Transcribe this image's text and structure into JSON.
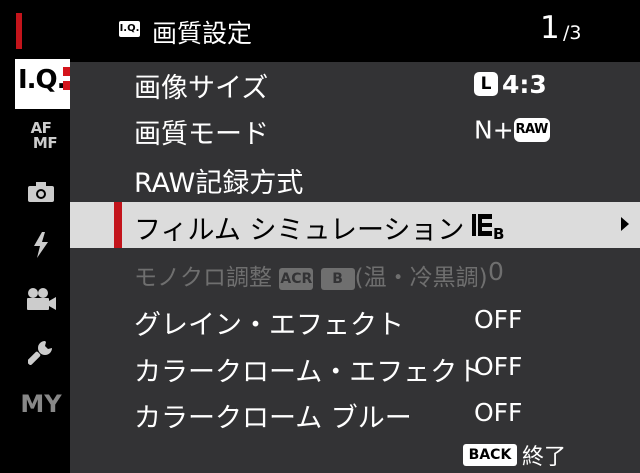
{
  "sidebar": {
    "iq_label": "I.Q.",
    "af_mf_top": "AF",
    "af_mf_bottom": "MF",
    "my_label": "MY",
    "items": [
      {
        "name": "iq-tab",
        "icon": "image-quality-icon",
        "active": true
      },
      {
        "name": "af-mf-tab",
        "icon": "af-mf-icon"
      },
      {
        "name": "shooting-tab",
        "icon": "camera-icon"
      },
      {
        "name": "flash-tab",
        "icon": "flash-icon"
      },
      {
        "name": "movie-tab",
        "icon": "movie-camera-icon"
      },
      {
        "name": "setup-tab",
        "icon": "wrench-icon"
      },
      {
        "name": "my-menu-tab",
        "icon": "my-menu-icon"
      }
    ]
  },
  "header": {
    "badge": "I.Q.",
    "title": "画質設定",
    "page_current": "1",
    "page_total": "/3"
  },
  "menu": {
    "items": [
      {
        "label": "画像サイズ",
        "value_badge": "L",
        "value": "4:3"
      },
      {
        "label": "画質モード",
        "value": "N+",
        "value_badge": "RAW"
      },
      {
        "label": "RAW記録方式",
        "value": ""
      },
      {
        "label": "フィルム シミュレーション",
        "value": "",
        "value_icon": "film-simulation-classic-chrome-icon",
        "selected": true
      },
      {
        "label_pre": "モノクロ調整",
        "label_badge1": "ACR",
        "label_badge2": "B",
        "label_post": "(温・冷黒調)",
        "value": "0",
        "disabled": true
      },
      {
        "label": "グレイン・エフェクト",
        "value": "OFF"
      },
      {
        "label": "カラークローム・エフェクト",
        "value": "OFF"
      },
      {
        "label": "カラークローム ブルー",
        "value": "OFF"
      }
    ]
  },
  "footer": {
    "back_label": "BACK",
    "end_label": "終了"
  },
  "colors": {
    "accent_red": "#c3141b",
    "panel_bg": "#333335",
    "selected_bg": "#dcdcdc",
    "disabled_text": "#6f6f6f"
  }
}
